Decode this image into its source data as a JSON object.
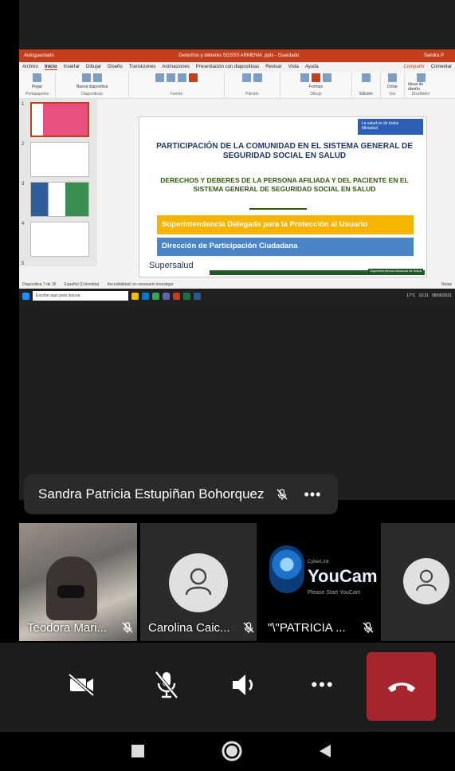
{
  "ppt": {
    "titlebar": {
      "autosave": "Autoguardado",
      "title": "Derechos y deberes SGSSS ARMENIA .pptx - Guardado",
      "user": "Sandra P"
    },
    "menu": [
      "Archivo",
      "Inicio",
      "Insertar",
      "Dibujar",
      "Diseño",
      "Transiciones",
      "Animaciones",
      "Presentación con diapositivas",
      "Revisar",
      "Vista",
      "Ayuda"
    ],
    "menu_active": "Inicio",
    "share": "Compartir",
    "comments": "Comentar",
    "ribbon_groups": [
      "Portapapeles",
      "Diapositivas",
      "Fuente",
      "Párrafo",
      "Dibujo",
      "Edición",
      "Voz",
      "Diseñador"
    ],
    "ribbon_labels": {
      "paste": "Pegar",
      "new_slide": "Nueva diapositiva",
      "reuse": "Volver a usar las diapositivas",
      "edit": "Edición",
      "dictate": "Dictar",
      "ideas": "Ideas de diseño",
      "shapes": "Formas",
      "arrange": "Organizar",
      "styles": "Estilos rápidos"
    },
    "thumb_numbers": [
      "1",
      "2",
      "3",
      "4",
      "5"
    ],
    "slide": {
      "logo_text": "La salud es de todos",
      "logo_sub": "Minsalud",
      "heading": "PARTICIPACIÓN DE LA COMUNIDAD EN EL SISTEMA GENERAL DE SEGURIDAD SOCIAL EN SALUD",
      "subheading": "DERECHOS Y DEBERES DE LA PERSONA AFILIADA Y DEL PACIENTE EN EL SISTEMA GENERAL DE SEGURIDAD SOCIAL EN SALUD",
      "bar1": "Superintendencia Delegada para la Protección al Usuario",
      "bar2": "Dirección de Participación Ciudadana",
      "brand": "Supersalud",
      "footer_tag": "Superintendencia Nacional de Salud"
    },
    "status": {
      "slide_count": "Diapositiva 7 de 36",
      "language": "Español (Colombia)",
      "accessibility": "Accesibilidad: es necesario investigar",
      "notes": "Notas"
    },
    "taskbar": {
      "search_placeholder": "Escribe aquí para buscar",
      "weather": "17°C",
      "time": "10:21",
      "date": "08/06/2021"
    }
  },
  "speaker": {
    "name": "Sandra Patricia Estupiñan Bohorquez",
    "more": "•••"
  },
  "tiles": [
    {
      "name": "Teodora Mari...",
      "muted": true,
      "kind": "video"
    },
    {
      "name": "Carolina Caic...",
      "muted": true,
      "kind": "avatar"
    },
    {
      "name": "\"\\\"PATRICIA ...",
      "muted": true,
      "kind": "youcam"
    },
    {
      "name": "",
      "muted": false,
      "kind": "avatar"
    }
  ],
  "youcam": {
    "cl": "CyberLink",
    "brand": "YouCam",
    "sub": "Please Start YouCam"
  },
  "controls": {
    "more": "•••"
  },
  "colors": {
    "end_call": "#a4262c",
    "ppt_accent": "#c43e1c",
    "slide_yellow": "#f5b400",
    "slide_blue": "#4a86c7"
  }
}
